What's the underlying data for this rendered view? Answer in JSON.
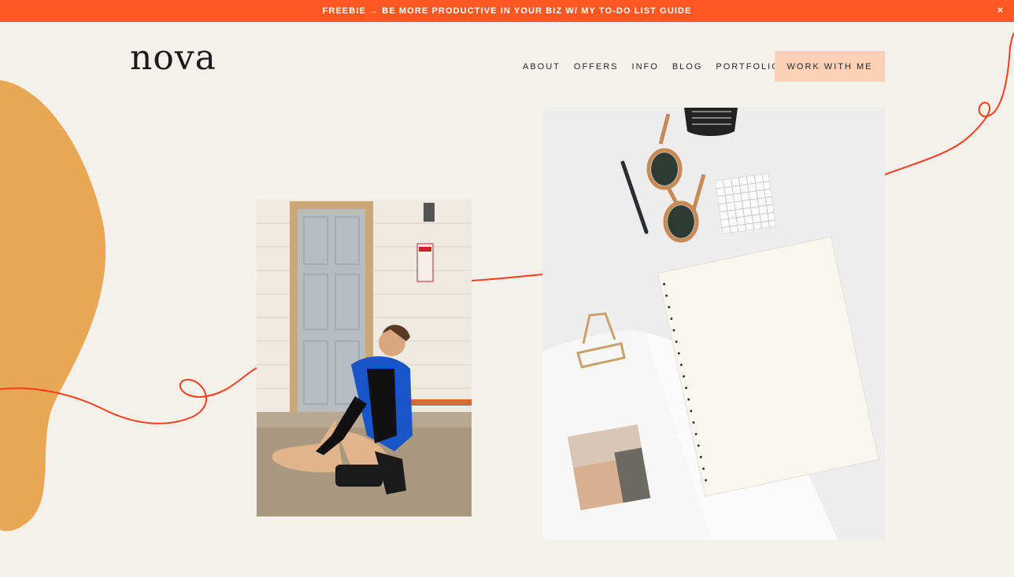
{
  "banner": {
    "text": "FREEBIE → BE MORE PRODUCTIVE IN YOUR BIZ W/ MY TO-DO LIST GUIDE",
    "close_icon": "×"
  },
  "logo": {
    "text": "nova"
  },
  "nav": {
    "items": [
      {
        "label": "ABOUT"
      },
      {
        "label": "OFFERS"
      },
      {
        "label": "INFO"
      },
      {
        "label": "BLOG"
      },
      {
        "label": "PORTFOLIO"
      }
    ],
    "cta_label": "WORK WITH ME"
  },
  "colors": {
    "banner": "#ff5722",
    "background": "#f4f1ed",
    "blob": "#e8a752",
    "line": "#ff3d1a",
    "cta_bg": "#fccfb6"
  },
  "images": {
    "left_photo": "woman-sitting-by-door-photo",
    "right_photo": "desk-flatlay-notebook-sunglasses-photo"
  }
}
